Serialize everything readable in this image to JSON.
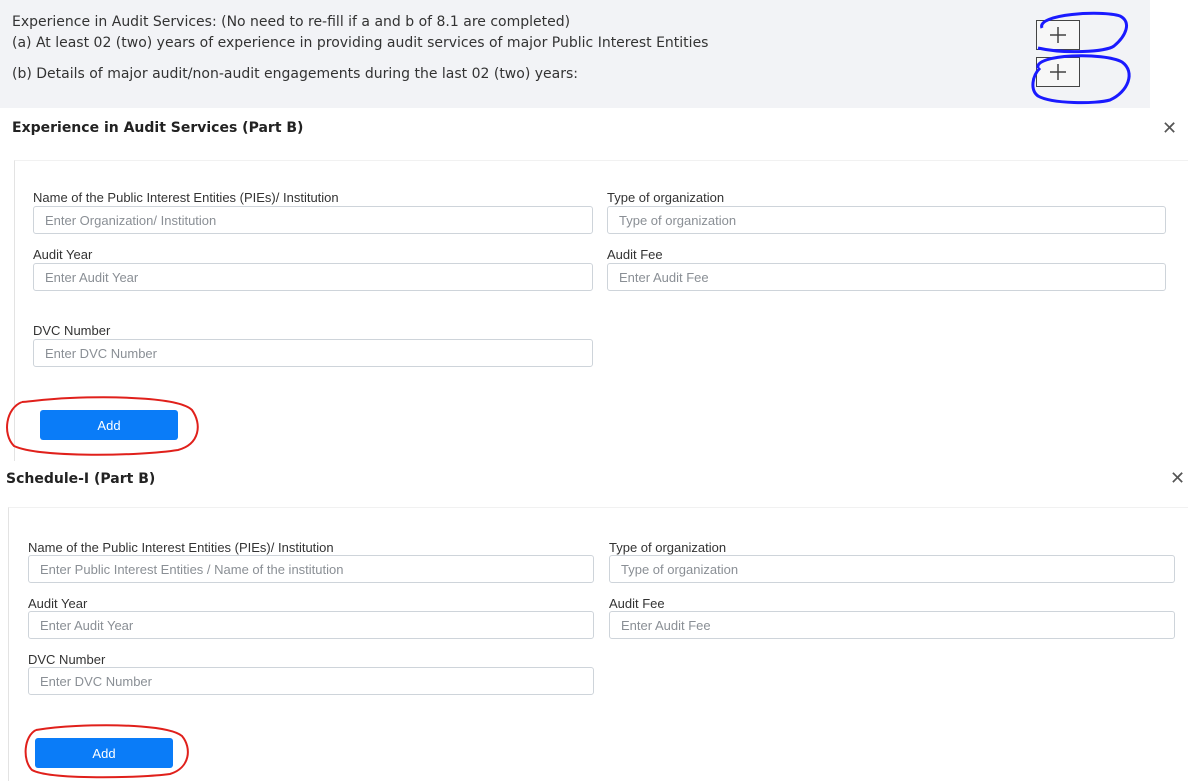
{
  "top_section": {
    "heading": "Experience in Audit Services: (No need to re-fill if a and b of 8.1 are completed)",
    "item_a": "(a) At least 02 (two) years of experience in providing audit services of major Public Interest Entities",
    "item_b": "(b) Details of major audit/non-audit engagements during the last 02 (two) years:",
    "annotation_color": "#1a1aff"
  },
  "modal_experience": {
    "title": "Experience in Audit Services (Part B)",
    "close_icon": "close-icon",
    "fields": {
      "name_label": "Name of the Public Interest Entities (PIEs)/ Institution",
      "name_placeholder": "Enter Organization/ Institution",
      "type_label": "Type of organization",
      "type_placeholder": "Type of organization",
      "year_label": "Audit Year",
      "year_placeholder": "Enter Audit Year",
      "fee_label": "Audit Fee",
      "fee_placeholder": "Enter Audit Fee",
      "dvc_label": "DVC Number",
      "dvc_placeholder": "Enter DVC Number"
    },
    "add_label": "Add"
  },
  "modal_schedule": {
    "title": "Schedule-I (Part B)",
    "close_icon": "close-icon",
    "fields": {
      "name_label": "Name of the Public Interest Entities (PIEs)/ Institution",
      "name_placeholder": "Enter Public Interest Entities / Name of the institution",
      "type_label": "Type of organization",
      "type_placeholder": "Type of organization",
      "year_label": "Audit Year",
      "year_placeholder": "Enter Audit Year",
      "fee_label": "Audit Fee",
      "fee_placeholder": "Enter Audit Fee",
      "dvc_label": "DVC Number",
      "dvc_placeholder": "Enter DVC Number"
    },
    "add_label": "Add"
  },
  "colors": {
    "primary_button": "#0a7cf8",
    "annotation_red": "#e0201b",
    "annotation_blue": "#1a1aff",
    "panel_bg": "#f2f3f6"
  }
}
